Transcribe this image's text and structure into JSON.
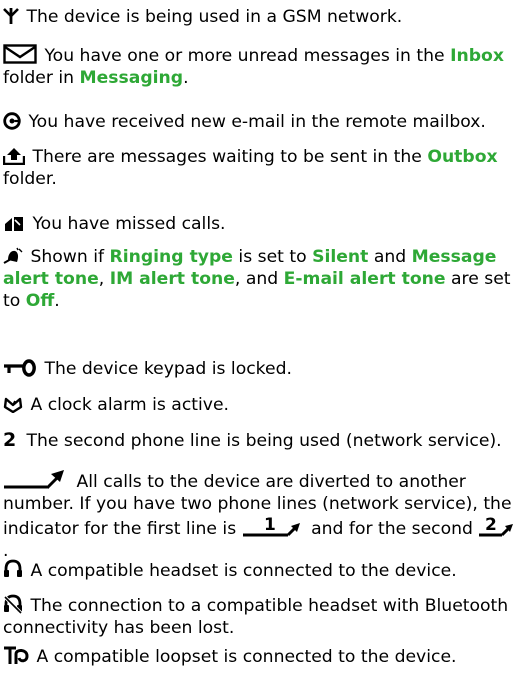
{
  "colors": {
    "text": "#000000",
    "link": "#2ea836",
    "background": "#ffffff"
  },
  "indicators": [
    {
      "icon": "signal-antenna-icon",
      "parts": [
        {
          "t": "The device is being used in a GSM network."
        }
      ]
    },
    {
      "icon": "envelope-icon",
      "parts": [
        {
          "t": "You have one or more unread messages in the "
        },
        {
          "t": "Inbox",
          "hl": true
        },
        {
          "t": " folder in "
        },
        {
          "t": "Messaging",
          "hl": true
        },
        {
          "t": "."
        }
      ]
    },
    {
      "icon": "at-sign-icon",
      "parts": [
        {
          "t": "You have received new e-mail in the remote mailbox."
        }
      ]
    },
    {
      "icon": "outbox-upload-icon",
      "parts": [
        {
          "t": "There are messages waiting to be sent in the "
        },
        {
          "t": "Outbox",
          "hl": true
        },
        {
          "t": " folder."
        }
      ]
    },
    {
      "icon": "missed-call-icon",
      "parts": [
        {
          "t": "You have missed calls."
        }
      ]
    },
    {
      "icon": "silent-bell-icon",
      "parts": [
        {
          "t": "Shown if "
        },
        {
          "t": "Ringing type",
          "hl": true
        },
        {
          "t": " is set to "
        },
        {
          "t": "Silent",
          "hl": true
        },
        {
          "t": " and "
        },
        {
          "t": "Message alert tone",
          "hl": true
        },
        {
          "t": ", "
        },
        {
          "t": "IM alert tone",
          "hl": true
        },
        {
          "t": ", and "
        },
        {
          "t": "E-mail alert tone",
          "hl": true
        },
        {
          "t": " are set to "
        },
        {
          "t": "Off",
          "hl": true
        },
        {
          "t": "."
        }
      ]
    },
    {
      "icon": "keypad-lock-key-icon",
      "parts": [
        {
          "t": "The device keypad is locked."
        }
      ]
    },
    {
      "icon": "alarm-clock-icon",
      "parts": [
        {
          "t": "A clock alarm is active."
        }
      ]
    },
    {
      "icon": "line-two-icon",
      "parts": [
        {
          "t": "The second phone line is being used (network service)."
        }
      ]
    },
    {
      "icon": "call-divert-icon",
      "parts": [
        {
          "t": "All calls to the device are diverted to another number. If you have two phone lines (network service), the indicator for the first line is "
        },
        {
          "icon": "divert-line-1-icon"
        },
        {
          "t": " and for the second "
        },
        {
          "icon": "divert-line-2-icon"
        },
        {
          "t": "."
        }
      ]
    },
    {
      "icon": "headset-icon",
      "parts": [
        {
          "t": "A compatible headset is connected to the device."
        }
      ]
    },
    {
      "icon": "headset-lost-icon",
      "parts": [
        {
          "t": "The connection to a compatible headset with Bluetooth connectivity has been lost."
        }
      ]
    },
    {
      "icon": "loopset-icon",
      "parts": [
        {
          "t": "A compatible loopset is connected to the device."
        }
      ]
    }
  ]
}
